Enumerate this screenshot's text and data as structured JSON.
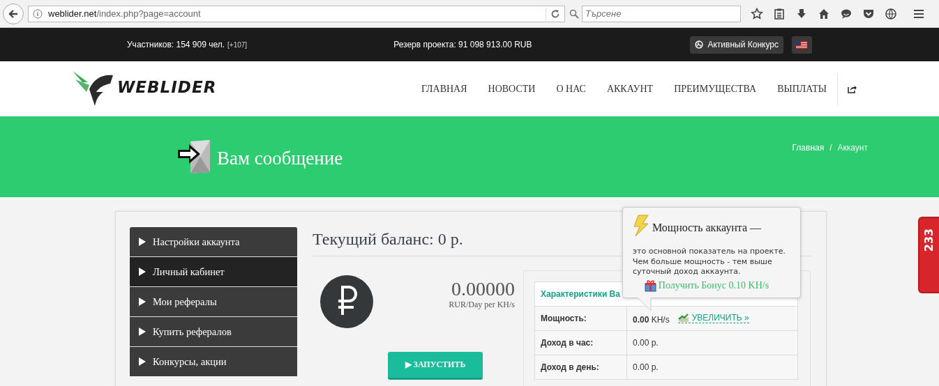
{
  "browser": {
    "url_host": "weblider.net",
    "url_path": "/index.php?page=account",
    "search_placeholder": "Търсене"
  },
  "top_bar": {
    "members": "Участников: 154 909 чел.",
    "members_delta": "[+107]",
    "reserve": "Резерв проекта: 91 098 913.00 RUB",
    "contest_button": "Активный Конкурс"
  },
  "header": {
    "logo": "WEBLIDER",
    "nav": [
      {
        "label": "ГЛАВНАЯ"
      },
      {
        "label": "НОВОСТИ"
      },
      {
        "label": "О НАС"
      },
      {
        "label": "АККАУНТ"
      },
      {
        "label": "ПРЕИМУЩЕСТВА"
      },
      {
        "label": "ВЫПЛАТЫ"
      }
    ]
  },
  "hero": {
    "title": "Вам сообщение",
    "breadcrumb": [
      {
        "label": "Главная",
        "kind": "link"
      },
      {
        "label": "Аккаунт",
        "kind": "current"
      }
    ],
    "breadcrumb_separator": "/"
  },
  "sidebar": {
    "items": [
      {
        "label": "Настройки аккаунта",
        "selected": false
      },
      {
        "label": "Личный кабинет",
        "selected": true
      },
      {
        "label": "Мои рефералы",
        "selected": false
      },
      {
        "label": "Купить рефералов",
        "selected": false
      },
      {
        "label": "Конкурсы, акции",
        "selected": false
      }
    ]
  },
  "balance": {
    "title": "Текущий баланс: 0 р.",
    "rate": "0.00000",
    "rate_unit": "RUR/Day per KH/s",
    "start_button": "▶ ЗАПУСТИТЬ"
  },
  "stats": {
    "heading": "Характеристики Ва",
    "rows": [
      {
        "label": "Мощность:",
        "value": "0.00",
        "unit": "KH/s",
        "action": "УВЕЛИЧИТЬ »"
      },
      {
        "label": "Доход в час:",
        "value": "0.00 р."
      },
      {
        "label": "Доход в день:",
        "value": "0.00 р."
      }
    ]
  },
  "tooltip": {
    "title": "Мощность аккаунта —",
    "text": "это основной показатель на проекте. Чем больше мощность - тем выше суточный доход аккаунта.",
    "bonus_link": "Получить Бонус 0.10 KH/s"
  },
  "side_badge": {
    "count": "233"
  }
}
